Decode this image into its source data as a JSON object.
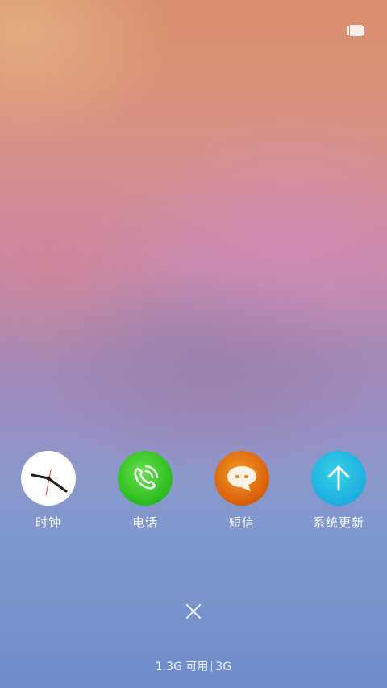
{
  "recents": {
    "toggle_icon": "recents-layout-icon"
  },
  "apps": [
    {
      "label": "时钟",
      "icon": "clock-icon",
      "color": "#ffffff"
    },
    {
      "label": "电话",
      "icon": "phone-icon",
      "color": "#3cc82a"
    },
    {
      "label": "短信",
      "icon": "message-icon",
      "color": "#e8720f"
    },
    {
      "label": "系统更新",
      "icon": "arrow-up-icon",
      "color": "#25bde3"
    }
  ],
  "close": {
    "icon": "close-icon"
  },
  "memory": {
    "available": "1.3G 可用",
    "total": "3G"
  }
}
